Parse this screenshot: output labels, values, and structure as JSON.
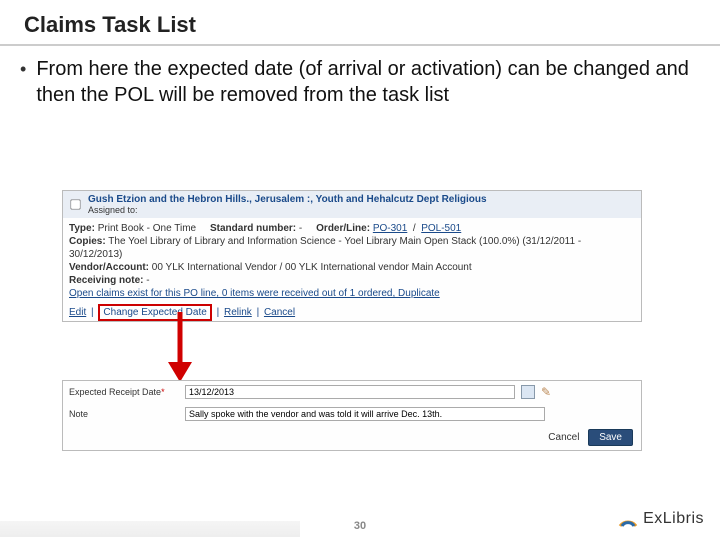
{
  "title": "Claims Task List",
  "bullet": "From here the expected date (of arrival or activation) can be changed and then the POL will be removed from the task list",
  "panel1": {
    "header_title": "Gush Etzion and the Hebron Hills., Jerusalem :, Youth and Hehalcutz Dept Religious",
    "assigned_label": "Assigned to:",
    "type_label": "Type:",
    "type_value": "Print Book - One Time",
    "std_label": "Standard number:",
    "std_value": "-",
    "orderline_label": "Order/Line:",
    "po_link": "PO-301",
    "slash": "/",
    "pol_link": "POL-501",
    "copies_label": "Copies:",
    "copies_value": "The Yoel Library of Library and Information Science - Yoel Library Main Open Stack (100.0%) (31/12/2011 - 30/12/2013)",
    "vendor_label": "Vendor/Account:",
    "vendor_value": "00 YLK International Vendor / 00 YLK International vendor Main Account",
    "recvnote_label": "Receiving note:",
    "recvnote_value": "-",
    "warning": "Open claims exist for this PO line, 0 items were received out of 1 ordered, Duplicate",
    "actions": {
      "edit": "Edit",
      "change": "Change Expected Date",
      "relink": "Relink",
      "cancel": "Cancel"
    }
  },
  "panel2": {
    "date_label": "Expected Receipt Date",
    "date_value": "13/12/2013",
    "note_label": "Note",
    "note_value": "Sally spoke with the vendor and was told it will arrive Dec. 13th.",
    "cancel": "Cancel",
    "save": "Save"
  },
  "page_number": "30",
  "logo_text": "ExLibris"
}
